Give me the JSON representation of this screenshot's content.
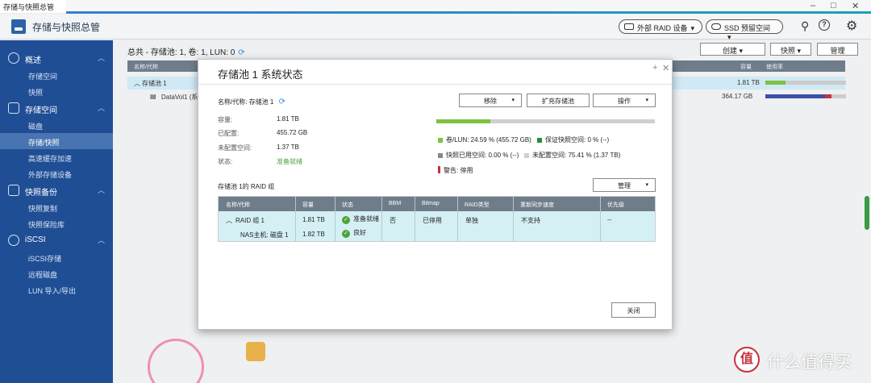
{
  "window": {
    "title": "存储与快照总管"
  },
  "app": {
    "title": "存储与快照总管",
    "ext_raid_label": "外部 RAID 设备",
    "ssd_label": "SSD 预留空间"
  },
  "sidebar": {
    "groups": [
      {
        "label": "概述",
        "items": [
          "存储空间",
          "快照"
        ]
      },
      {
        "label": "存储空间",
        "items": [
          "磁盘",
          "存储/快照",
          "高速缓存加速",
          "外部存储设备"
        ]
      },
      {
        "label": "快照备份",
        "items": [
          "快照复制",
          "快照保险库"
        ]
      },
      {
        "label": "iSCSI",
        "items": [
          "iSCSI存储",
          "远程磁盘",
          "LUN 导入/导出"
        ]
      }
    ],
    "active_item": "存储/快照"
  },
  "content": {
    "summary": "总共 - 存储池: 1, 卷: 1, LUN: 0",
    "buttons": {
      "create": "创建",
      "snapshot": "快照",
      "manage": "管理"
    },
    "columns": [
      "名称/代称",
      "容量",
      "使用率"
    ],
    "rows": [
      {
        "name": "存储池 1",
        "capacity": "1.81 TB",
        "usage": 0.2459
      },
      {
        "name": "DataVol1 (系",
        "capacity": "364.17 GB",
        "usage": 0.82
      }
    ]
  },
  "modal": {
    "title": "存储池 1 系统状态",
    "pool_label": "名称/代称:",
    "pool_name": "存储池 1",
    "info": [
      {
        "label": "容量:",
        "value": "1.81 TB"
      },
      {
        "label": "已配置:",
        "value": "455.72 GB"
      },
      {
        "label": "未配置空间:",
        "value": "1.37 TB"
      },
      {
        "label": "状态:",
        "value": "准备就绪"
      }
    ],
    "buttons": {
      "remove": "移除",
      "expand": "扩充存储池",
      "action": "操作",
      "manage": "管理",
      "close": "关闭"
    },
    "usage_fraction": 0.2459,
    "legend": {
      "vol_lun": "卷/LUN: 24.59 % (455.72 GB)",
      "guaranteed": "保证快照空间: 0 % (--)",
      "snap_used": "快照已用空间: 0.00 % (--)",
      "unconfigured": "未配置空间: 75.41 % (1.37 TB)",
      "warning": "警告: 停用"
    },
    "colors": {
      "vol_lun": "#7dc242",
      "guaranteed": "#2a8a3a",
      "snap_used": "#888888",
      "unconfigured": "#cfcfcf",
      "warning": "#c7323d"
    },
    "raid_group_title": "存储池 1的 RAID 组",
    "raid_columns": [
      "名称/代称",
      "容量",
      "状态",
      "BBM",
      "Bitmap",
      "RAID类型",
      "重新同步速度",
      "优先级"
    ],
    "raid_group": {
      "name": "RAID 组 1",
      "capacity": "1.81 TB",
      "status": "准备就绪",
      "bbm": "否",
      "bitmap": "已停用",
      "raid_type": "单独",
      "resync_speed": "不支持",
      "priority": "--"
    },
    "disk": {
      "name": "NAS主机: 磁盘 1",
      "capacity": "1.82 TB",
      "status": "良好"
    }
  },
  "watermark": {
    "text": "什么值得买",
    "icon_glyph": "值"
  }
}
